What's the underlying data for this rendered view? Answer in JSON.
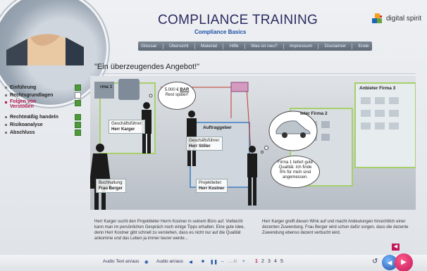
{
  "app": {
    "title": "COMPLIANCE TRAINING",
    "subtitle": "Compliance Basics"
  },
  "logo": {
    "text": "digital spirit",
    "colors": [
      "#f4a21d",
      "#1e63b5",
      "#67a33e",
      "#d12a2a"
    ]
  },
  "nav": {
    "items": [
      "Glossar",
      "Übersicht",
      "Material",
      "Hilfe",
      "Was ist neu?",
      "Impressum",
      "Disclaimer",
      "Ende"
    ]
  },
  "content": {
    "title": "\"Ein überzeugendes Angebot!\""
  },
  "sidebar": {
    "items": [
      {
        "label": "Einführung",
        "checked": true
      },
      {
        "label": "Rechtsgrundlagen",
        "checked": false
      },
      {
        "label": "Folgen von Verstößen",
        "checked": true,
        "active": true
      },
      {
        "label": "Rechtmäßig handeln",
        "checked": true
      },
      {
        "label": "Risikoanalyse",
        "checked": true
      },
      {
        "label": "Abschluss",
        "checked": true
      }
    ]
  },
  "scene": {
    "firma1": "rma 1",
    "firma2": "ieter Firma 2",
    "firma3": "Anbieter Firma 3",
    "auftraggeber": "Auftraggeber",
    "bubble_money": {
      "line1": "5.000 €",
      "bar": "BAR",
      "line2": "Rest später!"
    },
    "bubble_quality": "Firma 1 liefert gute Qualität. Ich finde 5% für mich sind angemessen.",
    "labels": {
      "gf_title": "Geschäftsführer:",
      "gf_name": "Herr Karger",
      "gf2_title": "Geschäftsführer:",
      "gf2_name": "Herr Stiller",
      "bh_title": "Buchhaltung:",
      "bh_name": "Frau Berger",
      "pl_title": "Projektleiter:",
      "pl_name": "Herr Kostner"
    }
  },
  "text": {
    "left": "Herr Karger sucht den Projektleiter Herrn Kostner in seinem Büro auf. Vielleicht kann man im persönlichen Gespräch noch einige Tipps erhalten. Eine gute Idee, denn Herr Kostner gibt schnell zu verstehen, dass es nicht nur auf die Qualität ankomme und das Leben ja immer teurer werde...",
    "right": "Herr Karger greift diesen Wink auf und macht Andeutungen hinsichtlich einer dezenten Zuwendung. Frau Berger wird schon dafür sorgen, dass die dezente Zuwendung ebenso dezent verbucht wird."
  },
  "controls": {
    "audio_text": "Audio Text an/aus",
    "audio": "Audio an/aus",
    "pages": [
      "1",
      "2",
      "3",
      "4",
      "5"
    ],
    "active_page": "1"
  }
}
